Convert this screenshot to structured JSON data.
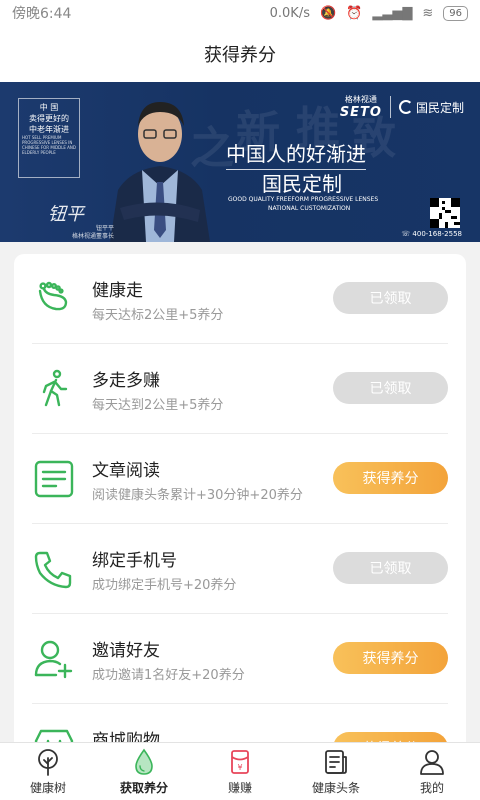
{
  "statusbar": {
    "time": "傍晚6:44",
    "speed": "0.0K/s",
    "battery": "96"
  },
  "title": "获得养分",
  "banner": {
    "box_title": "中 国",
    "box_line1": "卖得更好的",
    "box_line2": "中老年渐进",
    "box_small": "HOT SELL PREMIUM PROGRESSIVE LENSES IN CHINESE FOR MIDDLE AND ELDERLY PEOPLE",
    "brand_cn": "格林视通",
    "brand_en": "SETO",
    "brand_gm": "国民定制",
    "headline1": "中国人的好渐进",
    "headline2": "国民定制",
    "en_line1": "GOOD QUALITY FREEFORM PROGRESSIVE LENSES",
    "en_line2": "NATIONAL CUSTOMIZATION",
    "signature": "钮平",
    "sign_name": "钮平平",
    "sign_title": "格林视通董事长",
    "phone": "400-168-2558"
  },
  "tasks": [
    {
      "icon": "footprint-icon",
      "title": "健康走",
      "desc": "每天达标2公里+5养分",
      "button": "已领取",
      "claimed": true
    },
    {
      "icon": "walking-person-icon",
      "title": "多走多赚",
      "desc": "每天达到2公里+5养分",
      "button": "已领取",
      "claimed": true
    },
    {
      "icon": "document-icon",
      "title": "文章阅读",
      "desc": "阅读健康头条累计+30分钟+20养分",
      "button": "获得养分",
      "claimed": false
    },
    {
      "icon": "phone-icon",
      "title": "绑定手机号",
      "desc": "成功绑定手机号+20养分",
      "button": "已领取",
      "claimed": true
    },
    {
      "icon": "add-user-icon",
      "title": "邀请好友",
      "desc": "成功邀请1名好友+20养分",
      "button": "获得养分",
      "claimed": false
    },
    {
      "icon": "shop-icon",
      "title": "商城购物",
      "desc": "",
      "button": "获得养分",
      "claimed": false
    }
  ],
  "tabs": [
    {
      "icon": "tree-icon",
      "label": "健康树"
    },
    {
      "icon": "droplet-icon",
      "label": "获取养分",
      "active": true
    },
    {
      "icon": "red-envelope-icon",
      "label": "赚赚"
    },
    {
      "icon": "news-icon",
      "label": "健康头条"
    },
    {
      "icon": "profile-icon",
      "label": "我的"
    }
  ],
  "colors": {
    "green": "#3bb55a",
    "orange": "#f3a33a",
    "banner": "#1c3a6e"
  }
}
